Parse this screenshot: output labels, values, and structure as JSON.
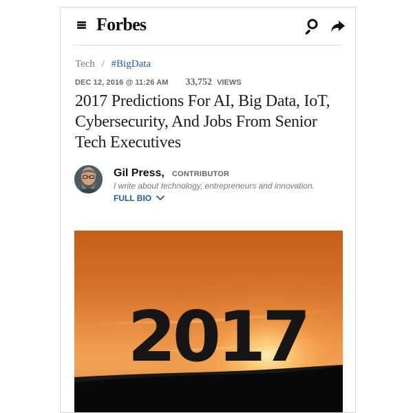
{
  "header": {
    "logo": "Forbes",
    "menu_icon": "menu-icon",
    "search_icon": "search-icon",
    "share_icon": "share-icon"
  },
  "breadcrumb": {
    "section": "Tech",
    "separator": "/",
    "channel": "#BigData"
  },
  "article": {
    "date": "DEC 12, 2016 @ 11:26 AM",
    "views_count": "33,752",
    "views_label": "VIEWS",
    "headline": "2017 Predictions For AI, Big Data, IoT, Cybersecurity, And Jobs From Senior Tech Executives"
  },
  "author": {
    "name": "Gil Press,",
    "role": "CONTRIBUTOR",
    "bio": "I write about technology, entrepreneurs and innovation.",
    "full_bio_label": "FULL BIO",
    "avatar_icon": "author-avatar"
  },
  "hero": {
    "number_text": "2017"
  },
  "colors": {
    "accent": "#1f5aa6",
    "text": "#1c1c1c",
    "muted": "#777777",
    "hero_orange": "#e98b3d"
  }
}
